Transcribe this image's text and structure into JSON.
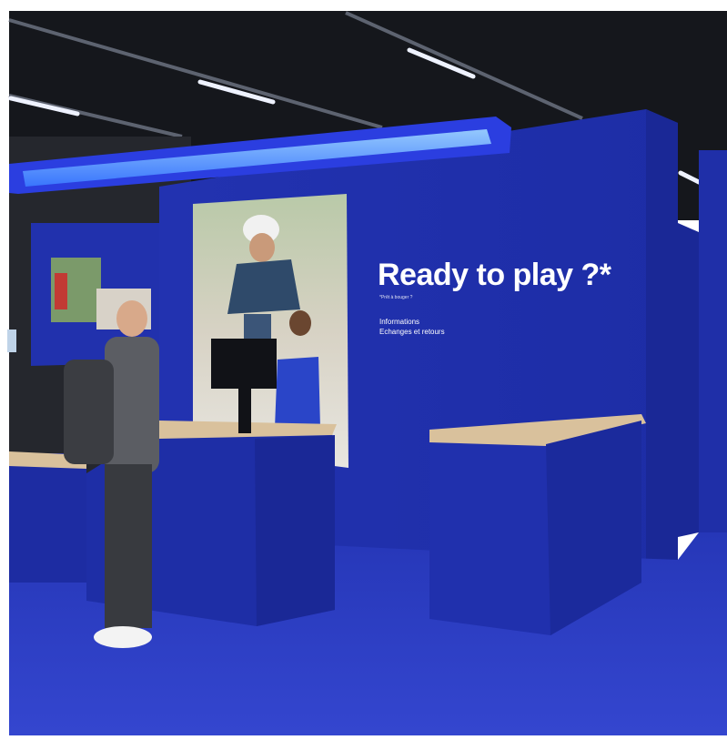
{
  "scene": {
    "description_kind": "photo",
    "colors": {
      "brand_blue": "#1f2fb0",
      "wall_blue": "#2233b5",
      "floor_blue": "#2b3ec2",
      "ceiling": "#16181d",
      "light_tube": "#5fa8ff",
      "countertop": "#d9c19c"
    }
  },
  "signage": {
    "headline": "Ready to play ?*",
    "subline": "*Prêt à bouger ?",
    "info_line_1": "Informations",
    "info_line_2": "Echanges et retours"
  },
  "icons": [
    "monitor-icon"
  ]
}
